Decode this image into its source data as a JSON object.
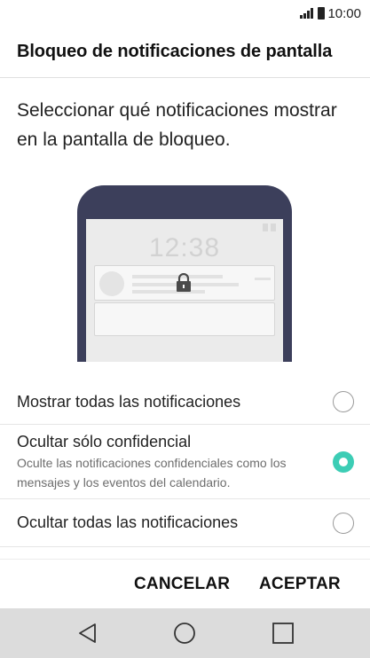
{
  "status_bar": {
    "time": "10:00",
    "icons": [
      "signal-icon",
      "battery-icon"
    ]
  },
  "header": {
    "title": "Bloqueo de notificaciones de pantalla"
  },
  "description": "Seleccionar qué notificaciones mostrar en la pantalla de bloqueo.",
  "illustration": {
    "clock": "12:38",
    "icons": [
      "lock-icon"
    ]
  },
  "options": [
    {
      "title": "Mostrar todas las notificaciones",
      "subtitle": "",
      "selected": false
    },
    {
      "title": "Ocultar sólo confidencial",
      "subtitle": "Oculte las notificaciones confidenciales como los mensajes y los eventos del calendario.",
      "selected": true
    },
    {
      "title": "Ocultar todas las notificaciones",
      "subtitle": "",
      "selected": false
    }
  ],
  "actions": {
    "cancel_label": "CANCELAR",
    "accept_label": "ACEPTAR"
  },
  "navbar": {
    "icons": [
      "back-icon",
      "home-icon",
      "recents-icon"
    ]
  },
  "colors": {
    "accent": "#3ccdb5",
    "phone_body": "#3c3f5b",
    "navbar": "#dcdcdc"
  }
}
